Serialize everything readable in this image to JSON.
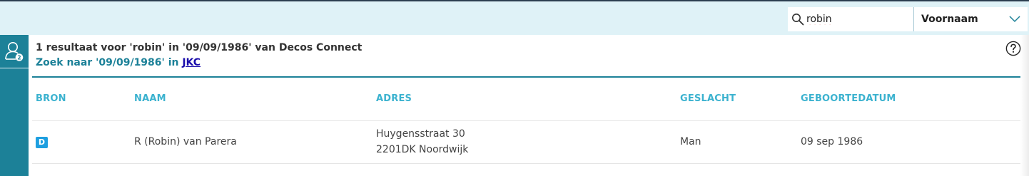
{
  "header": {
    "search": {
      "value": "robin"
    },
    "filter": {
      "selected": "Voornaam"
    }
  },
  "sidebar": {
    "badge_count": "2"
  },
  "results": {
    "summary": "1 resultaat voor 'robin' in '09/09/1986' van Decos Connect",
    "alt_search_prefix": "Zoek naar '09/09/1986' in ",
    "alt_search_link": "JKC",
    "columns": [
      "BRON",
      "NAAM",
      "ADRES",
      "GESLACHT",
      "GEBOORTEDATUM"
    ],
    "rows": [
      {
        "source": "D",
        "name": "R (Robin) van Parera",
        "address_line1": "Huygensstraat 30",
        "address_line2": "2201DK Noordwijk",
        "gender": "Man",
        "birthdate": "09 sep 1986"
      }
    ]
  },
  "colors": {
    "accent": "#1c8198",
    "header_bg": "#dff2f7",
    "column_header": "#3bb2cf",
    "source_badge": "#1e9fe0",
    "link": "#1a0dab"
  }
}
